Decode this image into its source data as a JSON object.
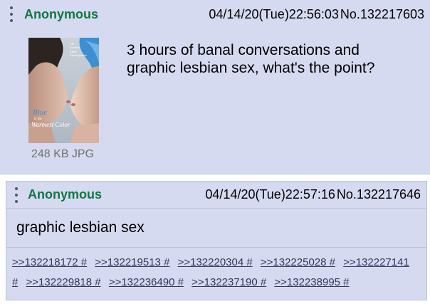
{
  "op": {
    "name": "Anonymous",
    "datetime": "04/14/20(Tue)22:56:03",
    "post_number": "No.132217603",
    "file_info": "248 KB JPG",
    "body_line1": "3 hours of banal conversations and",
    "body_line2": "graphic lesbian sex, what's the point?",
    "thumbnail": {
      "title_line1": "Blue",
      "title_line2": "is the",
      "title_line3": "Warmest Color",
      "small_credit1": "Léa",
      "small_credit2": "Seydoux",
      "small_credit3": "Adèle",
      "small_credit4": "Exarchopoulos"
    }
  },
  "reply": {
    "name": "Anonymous",
    "datetime": "04/14/20(Tue)22:57:16",
    "post_number": "No.132217646",
    "body": "graphic lesbian sex",
    "backlinks": [
      ">>132218172 #",
      ">>132219513 #",
      ">>132220304 #",
      ">>132225028 #",
      ">>132227141",
      "#",
      ">>132229818 #",
      ">>132236490 #",
      ">>132237190 #",
      ">>132238995 #"
    ]
  },
  "colors": {
    "post_background": "#d6daf0",
    "post_border": "#b7c5d9",
    "name": "#117743",
    "link": "#34345c",
    "file_info": "#707070"
  },
  "icons": {
    "post_menu": "vertical-ellipsis-icon"
  }
}
